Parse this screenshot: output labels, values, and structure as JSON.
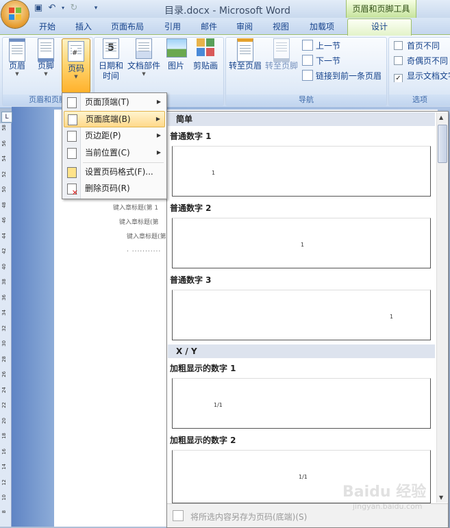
{
  "window": {
    "title": "目录.docx - Microsoft Word",
    "contextual_group": "页眉和页脚工具"
  },
  "tabs": [
    "开始",
    "插入",
    "页面布局",
    "引用",
    "邮件",
    "审阅",
    "视图",
    "加载项",
    "设计"
  ],
  "active_tab": "设计",
  "ribbon": {
    "group1": {
      "label": "页眉和页脚",
      "buttons": [
        "页眉",
        "页脚",
        "页码"
      ]
    },
    "group2": {
      "buttons": [
        "日期和时间",
        "文档部件",
        "图片",
        "剪贴画"
      ]
    },
    "group3": {
      "label": "导航",
      "buttons": [
        "转至页眉",
        "转至页脚"
      ],
      "small": [
        "上一节",
        "下一节",
        "链接到前一条页眉"
      ]
    },
    "group4": {
      "label": "选项",
      "checks": [
        {
          "label": "首页不同",
          "checked": false
        },
        {
          "label": "奇偶页不同",
          "checked": false
        },
        {
          "label": "显示文档文字",
          "checked": true
        }
      ]
    }
  },
  "date_btn_line1": "日期和",
  "date_btn_line2": "时间",
  "date_icon_number": "5",
  "page_icon_glyph": "#",
  "page_number_menu": [
    {
      "label": "页面顶端(T)",
      "has_submenu": true
    },
    {
      "label": "页面底端(B)",
      "has_submenu": true,
      "highlighted": true
    },
    {
      "label": "页边距(P)",
      "has_submenu": true
    },
    {
      "label": "当前位置(C)",
      "has_submenu": true
    },
    {
      "label": "设置页码格式(F)...",
      "has_submenu": false
    },
    {
      "label": "删除页码(R)",
      "has_submenu": false
    }
  ],
  "gallery": {
    "sections": [
      {
        "header": "简单",
        "items": [
          "普通数字 1",
          "普通数字 2",
          "普通数字 3"
        ]
      },
      {
        "header": "X / Y",
        "items": [
          "加粗显示的数字 1",
          "加粗显示的数字 2"
        ]
      }
    ],
    "footer": "将所选内容另存为页码(底端)(S)"
  },
  "document": {
    "toc_lines": [
      "键入章标题(第 1",
      "键入章标题(第",
      "键入章标题(第"
    ]
  },
  "vertical_ruler": [
    "58",
    "56",
    "54",
    "52",
    "50",
    "48",
    "46",
    "44",
    "42",
    "40",
    "38",
    "36",
    "34",
    "32",
    "30",
    "28",
    "26",
    "24",
    "22",
    "20",
    "18",
    "16",
    "14",
    "12",
    "10",
    "8"
  ],
  "watermark": {
    "main": "Baidu 经验",
    "sub": "jingyan.baidu.com"
  },
  "colors": {
    "ribbon_accent": "#15428b",
    "hover": "#ffd98a",
    "contextual": "#c6e39d"
  }
}
